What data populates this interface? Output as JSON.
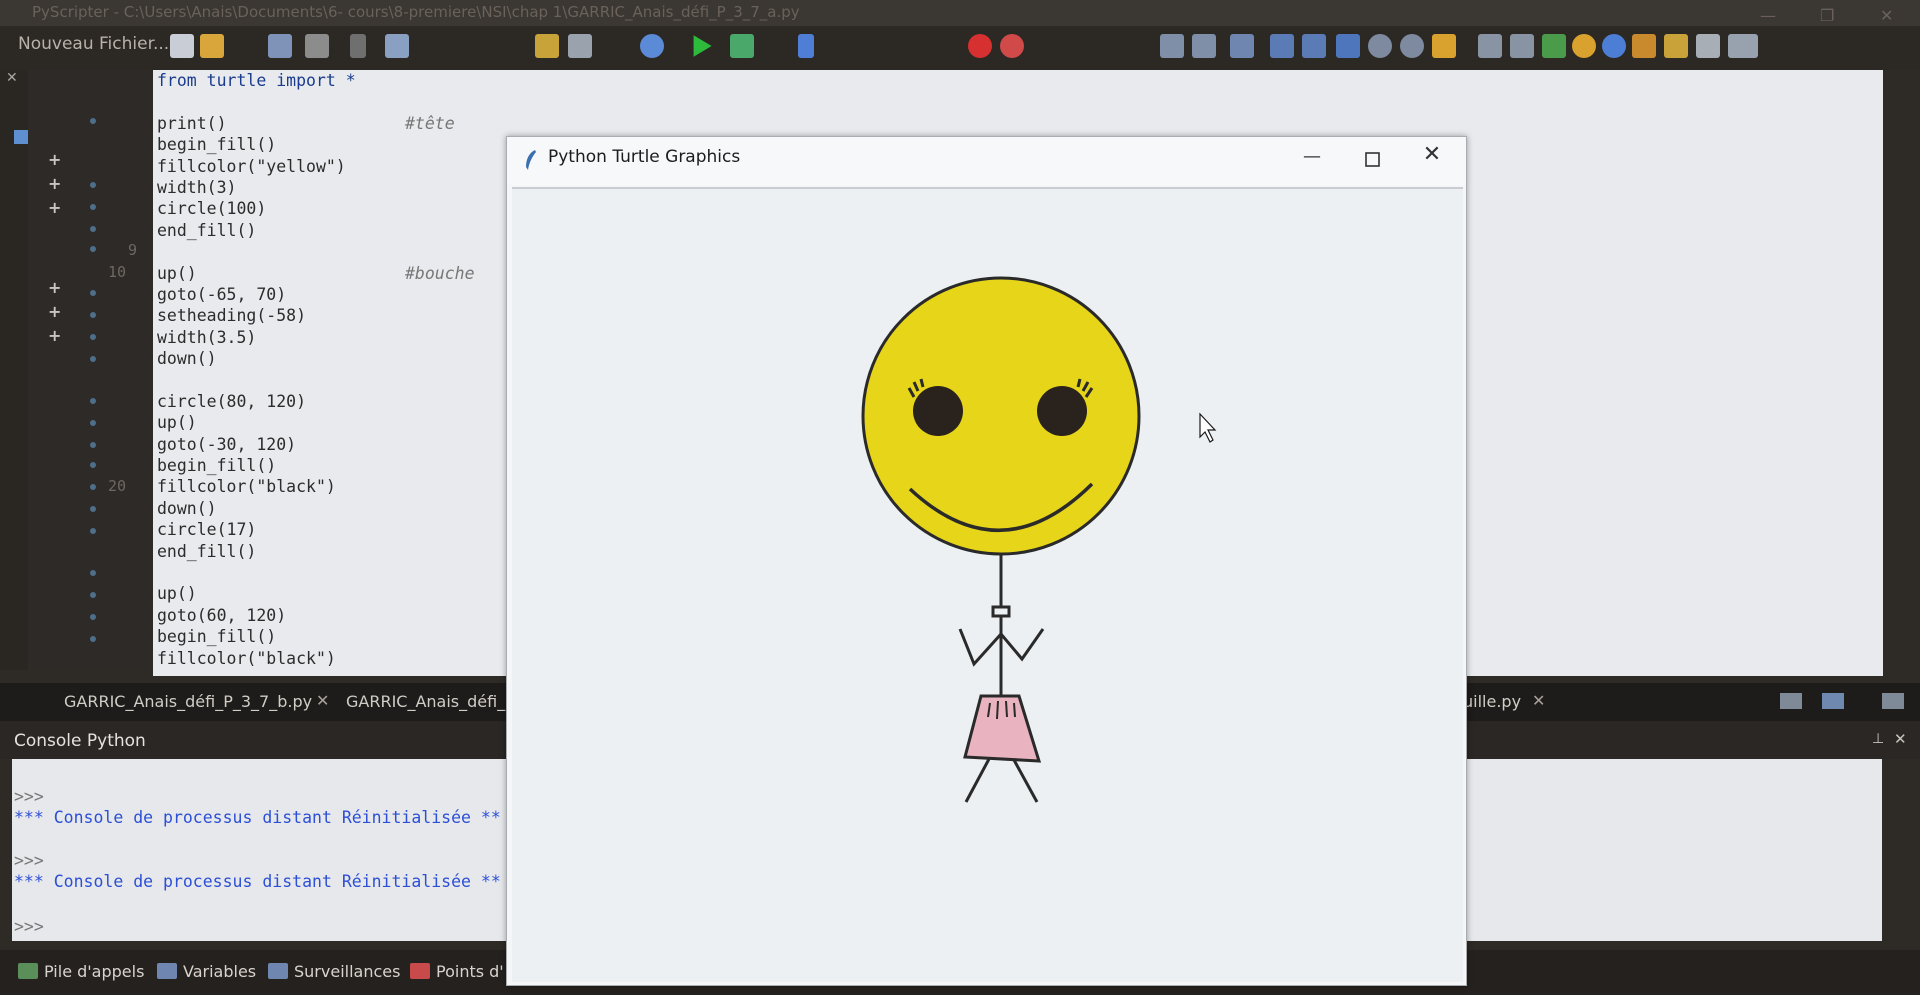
{
  "window": {
    "title": "PyScripter - C:\\Users\\Anais\\Documents\\6- cours\\8-premiere\\NSI\\chap 1\\GARRIC_Anais_défi_P_3_7_a.py"
  },
  "toolbar": {
    "new_file_label": "Nouveau Fichier..."
  },
  "editor": {
    "line_numbers": [
      "9",
      "10",
      "20"
    ],
    "code_lines": [
      {
        "text": "from turtle import *",
        "comment": ""
      },
      {
        "text": "",
        "comment": ""
      },
      {
        "text": "print()",
        "comment": "#tête"
      },
      {
        "text": "begin_fill()",
        "comment": ""
      },
      {
        "text": "fillcolor(\"yellow\")",
        "comment": ""
      },
      {
        "text": "width(3)",
        "comment": ""
      },
      {
        "text": "circle(100)",
        "comment": ""
      },
      {
        "text": "end_fill()",
        "comment": ""
      },
      {
        "text": "",
        "comment": ""
      },
      {
        "text": "up()",
        "comment": "#bouche"
      },
      {
        "text": "goto(-65, 70)",
        "comment": ""
      },
      {
        "text": "setheading(-58)",
        "comment": ""
      },
      {
        "text": "width(3.5)",
        "comment": ""
      },
      {
        "text": "down()",
        "comment": ""
      },
      {
        "text": "",
        "comment": ""
      },
      {
        "text": "circle(80, 120)",
        "comment": ""
      },
      {
        "text": "up()",
        "comment": ""
      },
      {
        "text": "goto(-30, 120)",
        "comment": ""
      },
      {
        "text": "begin_fill()",
        "comment": ""
      },
      {
        "text": "fillcolor(\"black\")",
        "comment": ""
      },
      {
        "text": "down()",
        "comment": ""
      },
      {
        "text": "circle(17)",
        "comment": ""
      },
      {
        "text": "end_fill()",
        "comment": ""
      },
      {
        "text": "",
        "comment": ""
      },
      {
        "text": "up()",
        "comment": ""
      },
      {
        "text": "goto(60, 120)",
        "comment": ""
      },
      {
        "text": "begin_fill()",
        "comment": ""
      },
      {
        "text": "fillcolor(\"black\")",
        "comment": ""
      }
    ]
  },
  "tabs": {
    "tab1": "GARRIC_Anais_défi_P_3_7_b.py",
    "tab2": "GARRIC_Anais_défi_P",
    "tab3": "uille.py"
  },
  "console": {
    "title": "Console Python",
    "prompt": ">>>",
    "message": "*** Console de processus distant Réinitialisée **"
  },
  "bottom_tabs": {
    "call_stack": "Pile d'appels",
    "variables": "Variables",
    "watches": "Surveillances",
    "breakpoints": "Points d'"
  },
  "turtle_window": {
    "title": "Python Turtle Graphics"
  },
  "colors": {
    "face": "#e7d51a",
    "skirt": "#e9b4c0",
    "console_message": "#2c4fd6"
  }
}
